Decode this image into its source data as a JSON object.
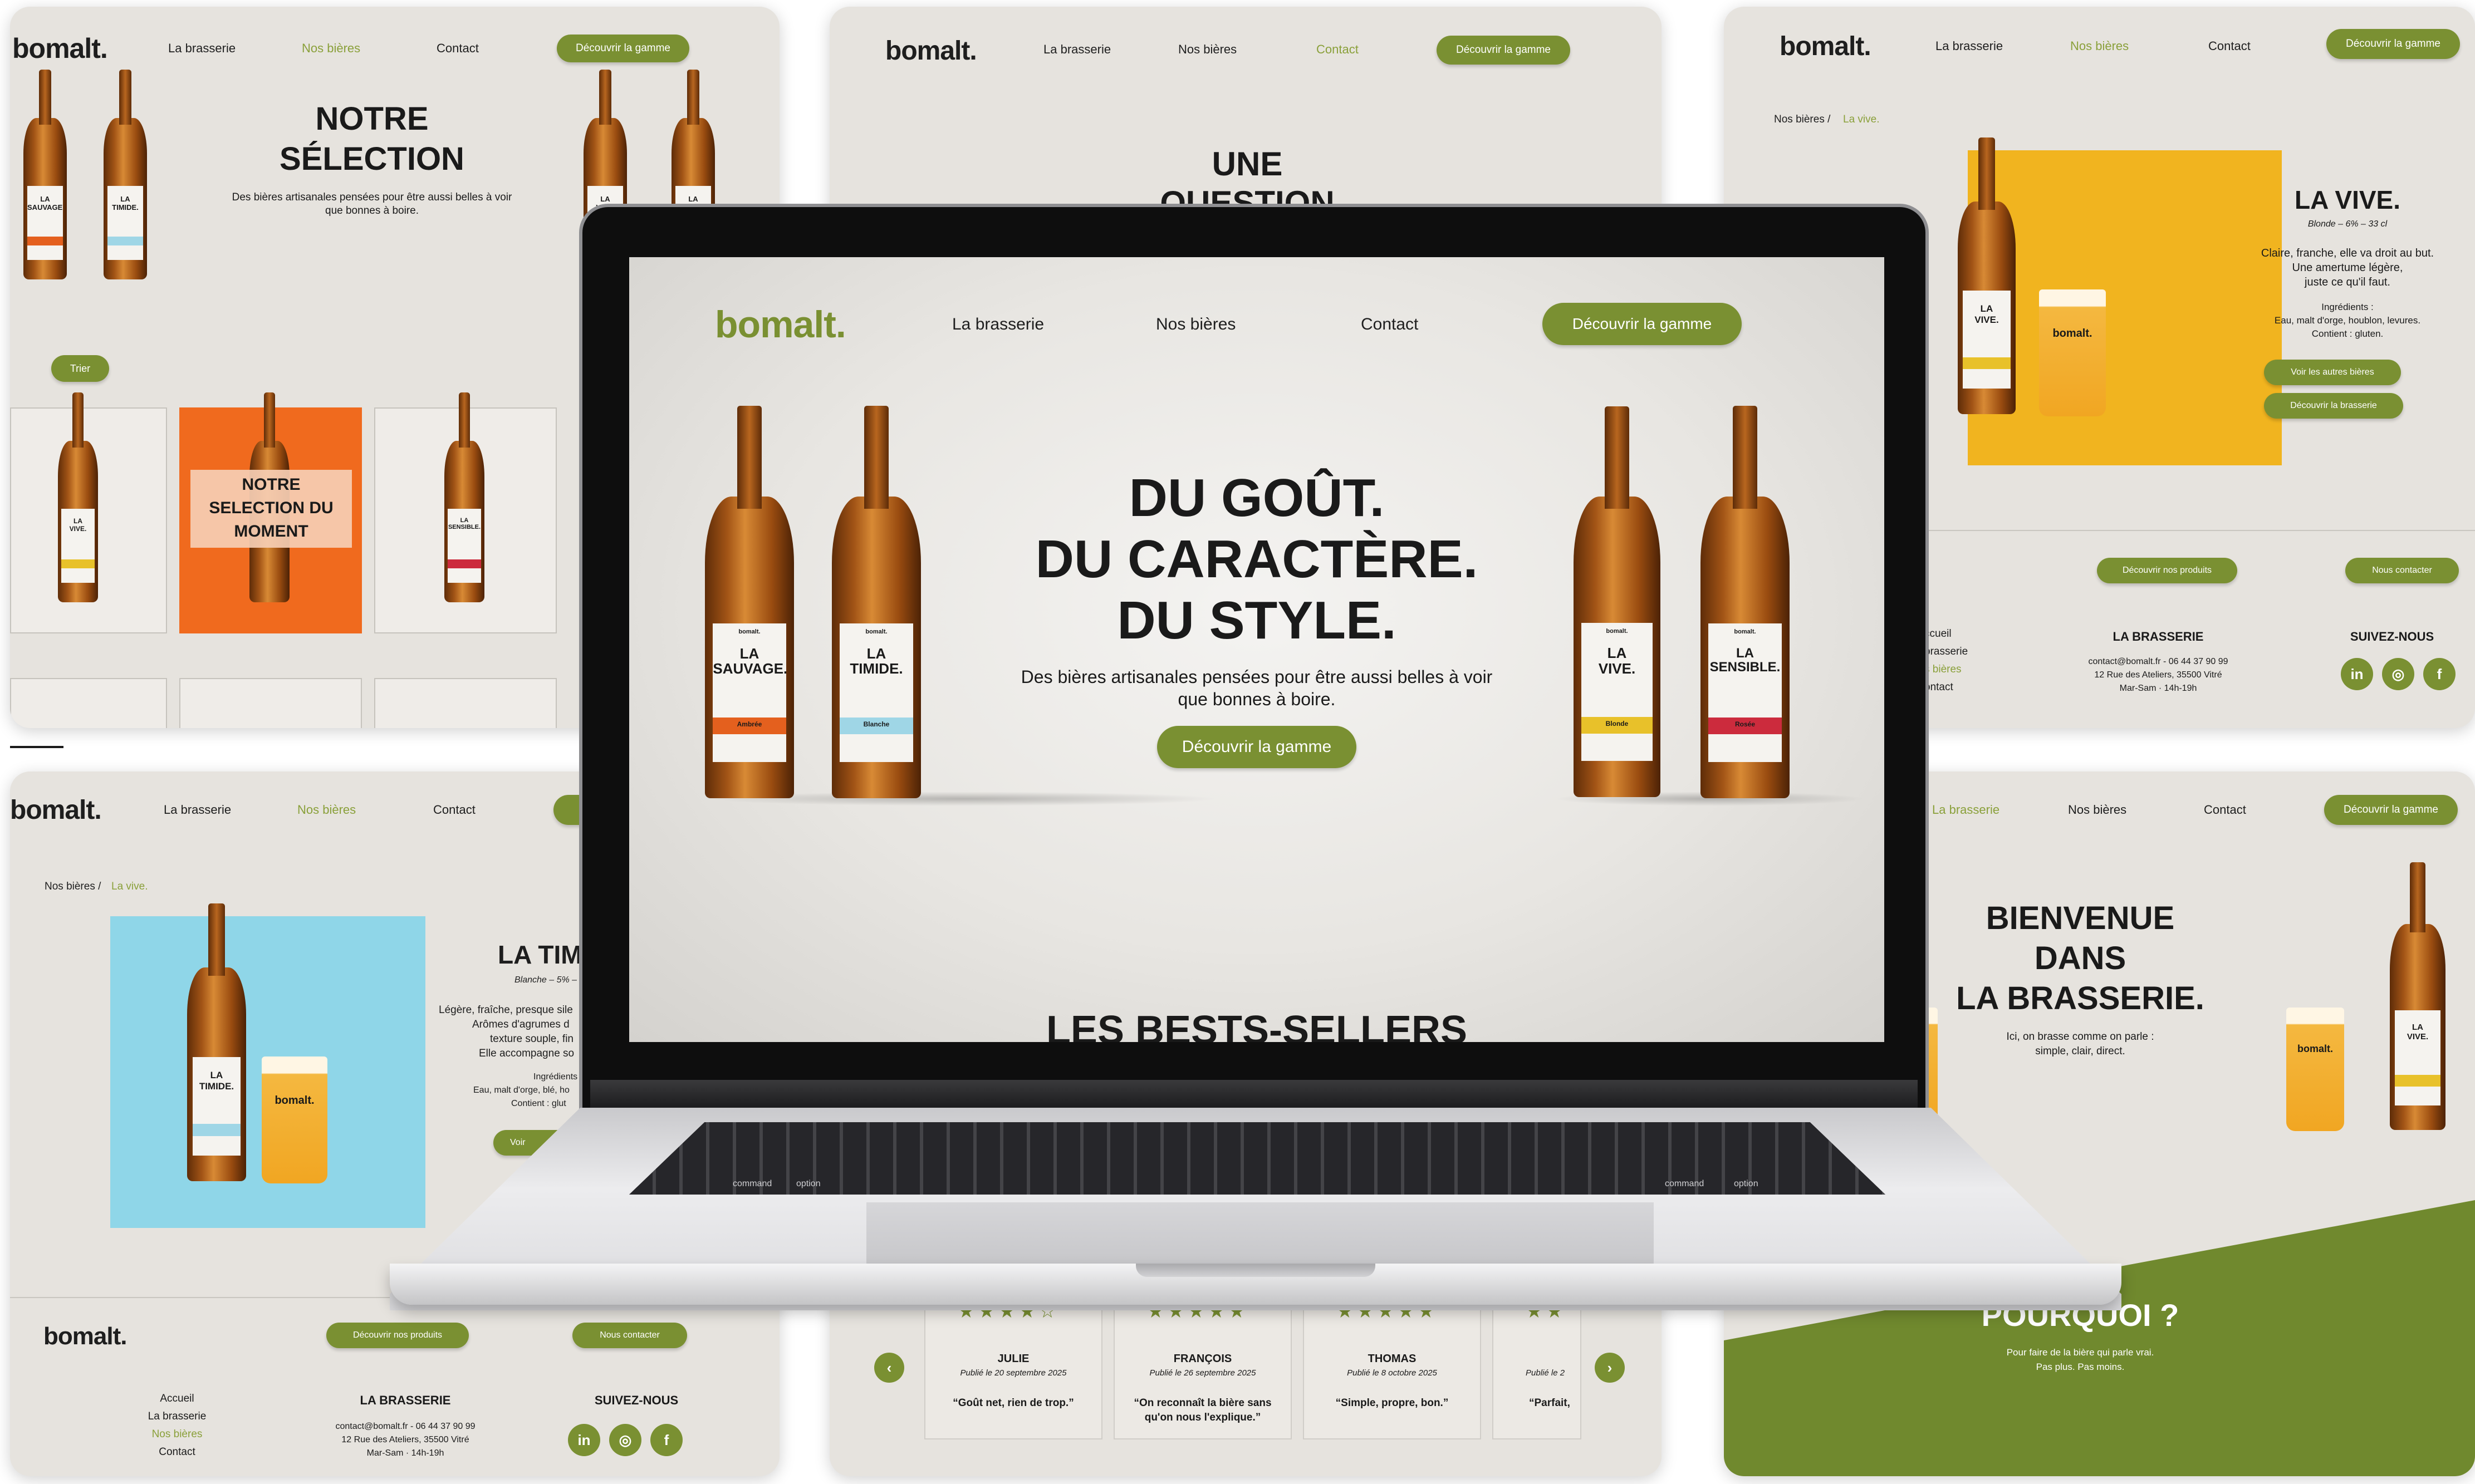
{
  "brand": {
    "logo": "bomalt.",
    "accent": "#7a9032",
    "background": "#e6e3de"
  },
  "nav": {
    "brasserie": "La brasserie",
    "bieres": "Nos bières",
    "contact": "Contact",
    "cta": "Découvrir la gamme"
  },
  "hero": {
    "line1": "DU GOÛT.",
    "line2": "DU CARACTÈRE.",
    "line3": "DU STYLE.",
    "subtitle1": "Des bières artisanales pensées pour être aussi belles à voir",
    "subtitle2": "que bonnes à boire.",
    "cta": "Découvrir la gamme",
    "next_section": "LES BESTS-SELLERS"
  },
  "beers": {
    "sauvage": {
      "brand": "bomalt.",
      "line1": "LA",
      "line2": "SAUVAGE.",
      "style": "Ambrée",
      "color": "#e4601e"
    },
    "timide": {
      "brand": "bomalt.",
      "line1": "LA",
      "line2": "TIMIDE.",
      "style": "Blanche",
      "color": "#9fd6e6"
    },
    "vive": {
      "brand": "bomalt.",
      "line1": "LA",
      "line2": "VIVE.",
      "style": "Blonde",
      "color": "#e8c12a"
    },
    "sensible": {
      "brand": "bomalt.",
      "line1": "LA",
      "line2": "SENSIBLE.",
      "style": "Rosée",
      "color": "#cc2b3d"
    }
  },
  "selection": {
    "title1": "NOTRE",
    "title2": "SÉLECTION",
    "subtitle1": "Des bières artisanales pensées pour être aussi belles à voir",
    "subtitle2": "que bonnes à boire.",
    "filter": "Trier",
    "overlay1": "NOTRE",
    "overlay2": "SELECTION DU",
    "overlay3": "MOMENT"
  },
  "question": {
    "line1": "UNE",
    "line2": "QUESTION"
  },
  "product_vive": {
    "breadcrumb_parent": "Nos bières /",
    "breadcrumb_current": "La vive.",
    "title": "LA VIVE.",
    "meta": "Blonde – 6% – 33 cl",
    "desc1": "Claire, franche, elle va droit au but.",
    "desc2": "Une amertume légère,",
    "desc3": "juste ce qu'il faut.",
    "ing_label": "Ingrédients :",
    "ing1": "Eau, malt d'orge, houblon, levures.",
    "ing2": "Contient : gluten.",
    "btn_other": "Voir les autres bières",
    "btn_brasserie": "Découvrir la brasserie"
  },
  "product_timide": {
    "breadcrumb_parent": "Nos bières /",
    "breadcrumb_current": "La vive.",
    "title": "LA TIMI",
    "meta": "Blanche – 5% –",
    "desc1": "Légère, fraîche, presque sile",
    "desc2": "Arômes d'agrumes d",
    "desc3": "texture souple, fin",
    "desc4": "Elle accompagne so",
    "ing_label": "Ingrédients",
    "ing1": "Eau, malt d'orge, blé, ho",
    "ing2": "Contient : glut",
    "btn": "Voir"
  },
  "footer": {
    "btn_products": "Découvrir nos produits",
    "btn_contact": "Nous contacter",
    "links": [
      "Accueil",
      "La brasserie",
      "Nos bières",
      "Contact"
    ],
    "links_cut": [
      "ccueil",
      "brasserie",
      "s bières",
      "ontact"
    ],
    "title": "LA BRASSERIE",
    "email": "contact@bomalt.fr - 06 44 37 90 99",
    "address": "12 Rue des Ateliers, 35500 Vitré",
    "hours": "Mar-Sam · 14h-19h",
    "follow": "SUIVEZ-NOUS",
    "social": [
      "in",
      "◎",
      "f"
    ]
  },
  "bienvenue": {
    "line1": "BIENVENUE",
    "line2": "DANS",
    "line3": "LA BRASSERIE.",
    "sub1": "Ici, on brasse comme on parle :",
    "sub2": "simple, clair, direct.",
    "why": "POURQUOI ?",
    "why_sub1": "Pour faire de la bière qui parle vrai.",
    "why_sub2": "Pas plus. Pas moins."
  },
  "reviews": [
    {
      "name": "JULIE",
      "date": "Publié le 20 septembre 2025",
      "quote1": "“Goût net, rien de trop.”",
      "quote2": "",
      "rating": 4
    },
    {
      "name": "FRANÇOIS",
      "date": "Publié le 26 septembre 2025",
      "quote1": "“On reconnaît la bière sans",
      "quote2": "qu'on nous l'explique.”",
      "rating": 5
    },
    {
      "name": "THOMAS",
      "date": "Publié le 8 octobre 2025",
      "quote1": "“Simple, propre, bon.”",
      "quote2": "",
      "rating": 5
    },
    {
      "name": "",
      "date": "Publié le 2",
      "quote1": "“Parfait,",
      "quote2": "",
      "rating": 2
    }
  ],
  "stars": {
    "r4": "★★★★☆",
    "r5": "★★★★★",
    "r2": "★★"
  },
  "arrows": {
    "prev": "‹",
    "next": "›"
  },
  "keyboard": {
    "command": "command",
    "option": "option"
  }
}
